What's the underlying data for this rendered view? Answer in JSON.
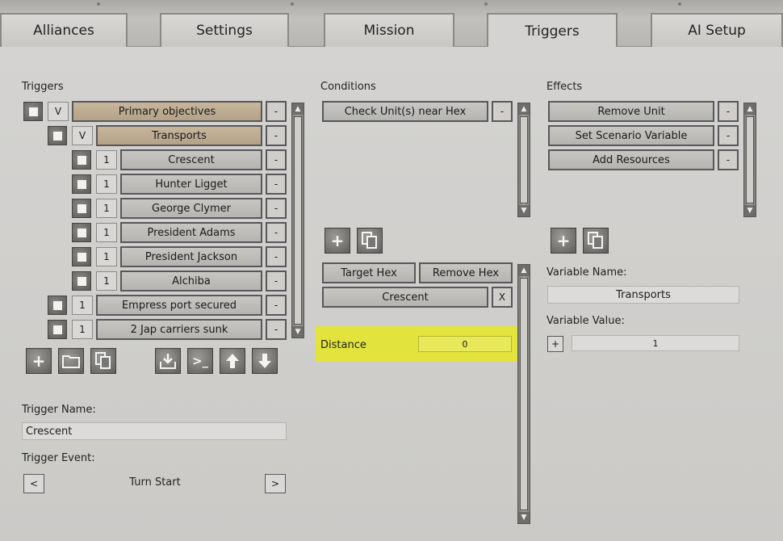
{
  "tabs": [
    "Alliances",
    "Settings",
    "Mission",
    "Triggers",
    "AI Setup"
  ],
  "active_tab": "Triggers",
  "triggers": {
    "header": "Triggers",
    "rows": [
      {
        "badge": "V",
        "label": "Primary objectives",
        "level": 0,
        "style": "tan"
      },
      {
        "badge": "V",
        "label": "Transports",
        "level": 1,
        "style": "tan"
      },
      {
        "badge": "1",
        "label": "Crescent",
        "level": 2,
        "style": "selected"
      },
      {
        "badge": "1",
        "label": "Hunter Ligget",
        "level": 2,
        "style": "normal"
      },
      {
        "badge": "1",
        "label": "George Clymer",
        "level": 2,
        "style": "normal"
      },
      {
        "badge": "1",
        "label": "President Adams",
        "level": 2,
        "style": "normal"
      },
      {
        "badge": "1",
        "label": "President Jackson",
        "level": 2,
        "style": "normal"
      },
      {
        "badge": "1",
        "label": "Alchiba",
        "level": 2,
        "style": "normal"
      },
      {
        "badge": "1",
        "label": "Empress port secured",
        "level": 1,
        "style": "normal"
      },
      {
        "badge": "1",
        "label": "2 Jap carriers sunk",
        "level": 1,
        "style": "normal"
      }
    ],
    "remove_label": "-",
    "trigger_name_label": "Trigger Name:",
    "trigger_name_value": "Crescent",
    "trigger_event_label": "Trigger Event:",
    "trigger_event_value": "Turn Start",
    "prev_label": "<",
    "next_label": ">"
  },
  "conditions": {
    "header": "Conditions",
    "items": [
      "Check Unit(s) near Hex"
    ],
    "target_hex_label": "Target Hex",
    "remove_hex_label": "Remove Hex",
    "hex_value": "Crescent",
    "hex_clear": "X",
    "distance_label": "Distance",
    "distance_value": "0"
  },
  "effects": {
    "header": "Effects",
    "items": [
      "Remove Unit",
      "Set Scenario Variable",
      "Add Resources"
    ],
    "variable_name_label": "Variable Name:",
    "variable_name_value": "Transports",
    "variable_value_label": "Variable Value:",
    "variable_value": "1",
    "plus_label": "+"
  },
  "icons": {
    "add": "+",
    "folder": "folder-icon",
    "copy": "copy-icon",
    "import": "import-icon",
    "console": ">_",
    "up": "up-arrow-icon",
    "down": "down-arrow-icon"
  },
  "colors": {
    "highlight": "#e2e33c",
    "tan_row": "#c3b297"
  }
}
